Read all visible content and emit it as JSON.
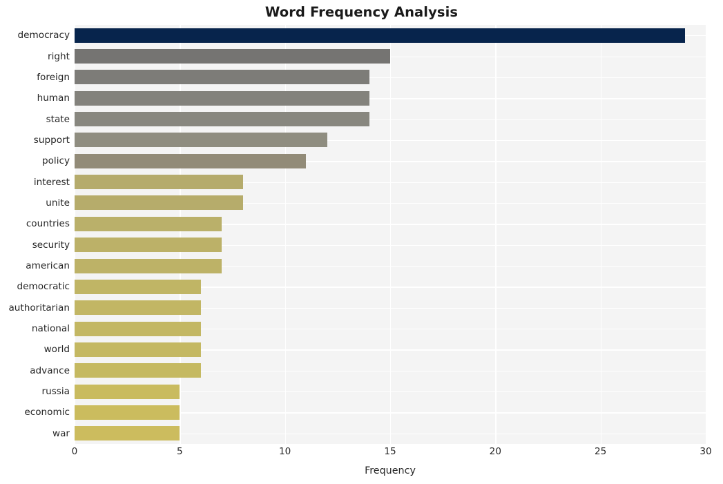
{
  "chart_data": {
    "type": "bar",
    "orientation": "horizontal",
    "title": "Word Frequency Analysis",
    "xlabel": "Frequency",
    "ylabel": "",
    "xlim": [
      0,
      30
    ],
    "xticks": [
      0,
      5,
      10,
      15,
      20,
      25,
      30
    ],
    "xtick_labels": [
      "0",
      "5",
      "10",
      "15",
      "20",
      "25",
      "30"
    ],
    "grid": true,
    "grid_axis": "both",
    "grid_color": "#ffffff",
    "plot_background": "#f4f4f4",
    "figure_background": "#ffffff",
    "legend": "none",
    "categories": [
      "democracy",
      "right",
      "foreign",
      "human",
      "state",
      "support",
      "policy",
      "interest",
      "unite",
      "countries",
      "security",
      "american",
      "democratic",
      "authoritarian",
      "national",
      "world",
      "advance",
      "russia",
      "economic",
      "war"
    ],
    "values": [
      29,
      15,
      14,
      14,
      14,
      12,
      11,
      8,
      8,
      7,
      7,
      7,
      6,
      6,
      6,
      6,
      6,
      5,
      5,
      5
    ],
    "bar_colors": [
      "#07244c",
      "#757472",
      "#7d7c78",
      "#83827c",
      "#88877f",
      "#8f8d80",
      "#928b78",
      "#b5ab6c",
      "#b6ac6b",
      "#bab06a",
      "#bcb168",
      "#bdb267",
      "#c0b565",
      "#c2b664",
      "#c3b763",
      "#c4b862",
      "#c5b961",
      "#c9bb5f",
      "#cbbc5e",
      "#ccbc5e"
    ],
    "series": [
      {
        "name": "Frequency",
        "values": [
          29,
          15,
          14,
          14,
          14,
          12,
          11,
          8,
          8,
          7,
          7,
          7,
          6,
          6,
          6,
          6,
          6,
          5,
          5,
          5
        ]
      }
    ]
  }
}
